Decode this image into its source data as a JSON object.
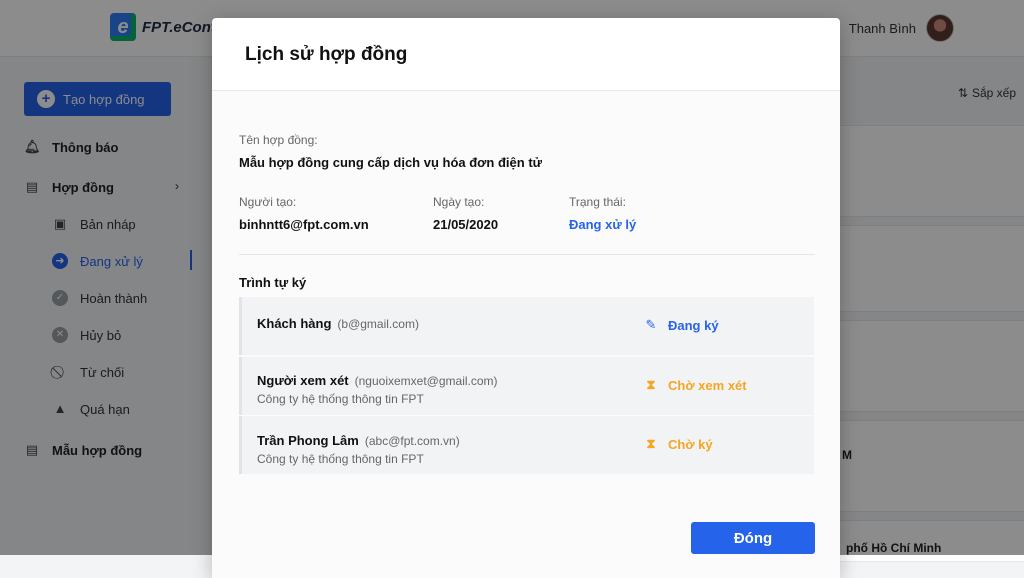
{
  "app": {
    "logo_text": "FPT.eContr",
    "user_name": "Thanh Bình"
  },
  "sidebar": {
    "create_label": "Tạo hợp đồng",
    "notifications": "Thông báo",
    "contracts": "Hợp đồng",
    "sub_items": [
      {
        "label": "Bản nháp"
      },
      {
        "label": "Đang xử lý"
      },
      {
        "label": "Hoàn thành"
      },
      {
        "label": "Hủy bỏ"
      },
      {
        "label": "Từ chối"
      },
      {
        "label": "Quá hạn"
      }
    ],
    "templates": "Mẫu hợp đồng"
  },
  "main": {
    "sort_label": "Sắp xếp",
    "peek_text_1": "M",
    "peek_text_2": "phố Hồ Chí Minh"
  },
  "modal": {
    "title": "Lịch sử hợp đồng",
    "contract_name_label": "Tên hợp đồng:",
    "contract_name": "Mẫu hợp đồng cung cấp dịch vụ hóa đơn điện tử",
    "creator_label": "Người tạo:",
    "creator": "binhntt6@fpt.com.vn",
    "created_date_label": "Ngày tạo:",
    "created_date": "21/05/2020",
    "status_label": "Trạng thái:",
    "status": "Đang xử lý",
    "sequence_title": "Trình tự ký",
    "steps": [
      {
        "name": "Khách hàng",
        "email": "(b@gmail.com)",
        "company": "",
        "status": "Đang ký"
      },
      {
        "name": "Người xem xét",
        "email": "(nguoixemxet@gmail.com)",
        "company": "Công ty hệ thống thông tin FPT",
        "status": "Chờ xem xét"
      },
      {
        "name": "Trần Phong Lâm",
        "email": "(abc@fpt.com.vn)",
        "company": "Công ty hệ thống thông tin FPT",
        "status": "Chờ ký"
      }
    ],
    "close_label": "Đóng"
  },
  "colors": {
    "primary": "#2563eb",
    "pending": "#f5a623"
  }
}
